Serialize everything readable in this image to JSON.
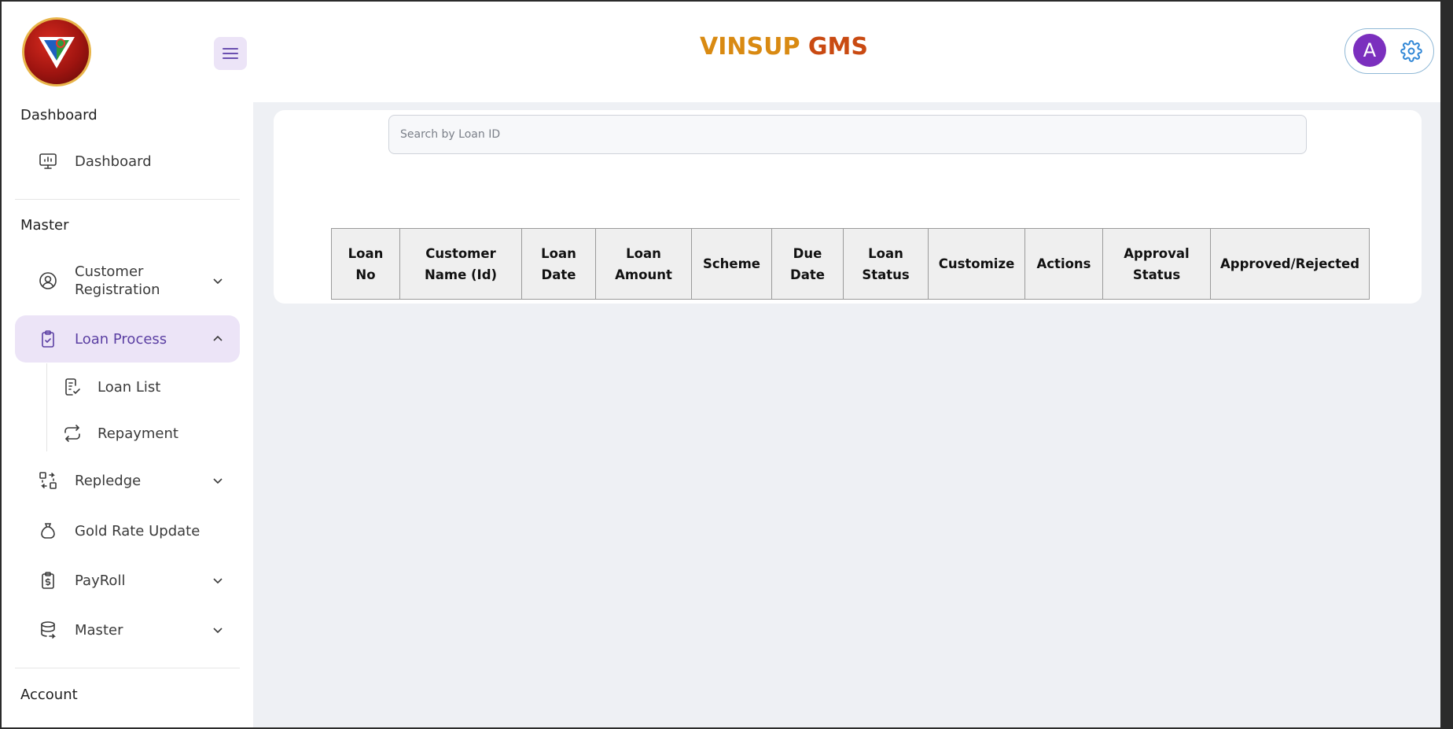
{
  "app": {
    "title_part1": "VINSUP",
    "title_part2": "GMS"
  },
  "user": {
    "avatar_letter": "A"
  },
  "sidebar": {
    "sections": {
      "dashboard": "Dashboard",
      "master": "Master",
      "account": "Account"
    },
    "items": [
      {
        "label": "Dashboard",
        "icon": "monitor-icon"
      },
      {
        "label": "Customer Registration",
        "icon": "user-circle-icon"
      },
      {
        "label": "Loan Process",
        "icon": "clipboard-check-icon"
      },
      {
        "label": "Repledge",
        "icon": "swap-icon"
      },
      {
        "label": "Gold Rate Update",
        "icon": "money-bag-icon"
      },
      {
        "label": "PayRoll",
        "icon": "payroll-clipboard-icon"
      },
      {
        "label": "Master",
        "icon": "database-icon"
      }
    ],
    "sub_items": [
      {
        "label": "Loan List",
        "icon": "list-check-icon"
      },
      {
        "label": "Repayment",
        "icon": "repeat-icon"
      }
    ]
  },
  "search": {
    "placeholder": "Search by Loan ID"
  },
  "table": {
    "columns": [
      "Loan No",
      "Customer Name (Id)",
      "Loan Date",
      "Loan Amount",
      "Scheme",
      "Due Date",
      "Loan Status",
      "Customize",
      "Actions",
      "Approval Status",
      "Approved/Rejected"
    ],
    "rows": []
  },
  "colors": {
    "accent": "#5b3fa3",
    "active_bg": "#ece4f7",
    "title_orange": "#d98a12",
    "title_red": "#c94a12",
    "avatar": "#7b2fbe"
  }
}
